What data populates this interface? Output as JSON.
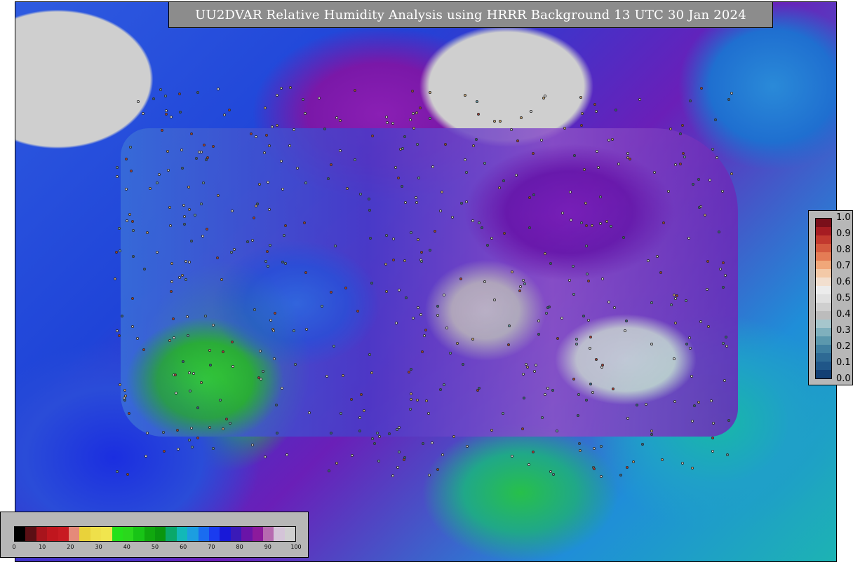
{
  "title": "UU2DVAR Relative Humidity Analysis using HRRR Background 13 UTC 30 Jan 2024",
  "right_colorbar": {
    "ticks": [
      "1.0",
      "0.9",
      "0.8",
      "0.7",
      "0.6",
      "0.5",
      "0.4",
      "0.3",
      "0.2",
      "0.1",
      "0.0"
    ],
    "colors": [
      "#7a0f1a",
      "#a61c22",
      "#c2392e",
      "#d45a3f",
      "#e47c55",
      "#f0a779",
      "#f3c9a7",
      "#f2dfcf",
      "#ececec",
      "#e0e0e0",
      "#cfcfcf",
      "#bcbcbc",
      "#a6c6cc",
      "#7fb0bd",
      "#5b98ad",
      "#3f7fa0",
      "#2e6a94",
      "#1f5688",
      "#123f74"
    ]
  },
  "bottom_colorbar": {
    "ticks": [
      "0",
      "10",
      "20",
      "30",
      "40",
      "50",
      "60",
      "70",
      "80",
      "90",
      "100"
    ],
    "colors": [
      "#000000",
      "#5a0f14",
      "#a8141c",
      "#c0161e",
      "#c81a22",
      "#e58a7a",
      "#e9d23a",
      "#efe04a",
      "#f0e54e",
      "#24e01a",
      "#2ad81c",
      "#18c416",
      "#10a80e",
      "#0a960e",
      "#0aa86a",
      "#12b8b8",
      "#1c9ee0",
      "#1a6cf0",
      "#1a3cf0",
      "#1818d8",
      "#3a1ab8",
      "#6a14a8",
      "#8c1a9c",
      "#b66ab0",
      "#d4c4d8",
      "#d0d0d0"
    ]
  }
}
